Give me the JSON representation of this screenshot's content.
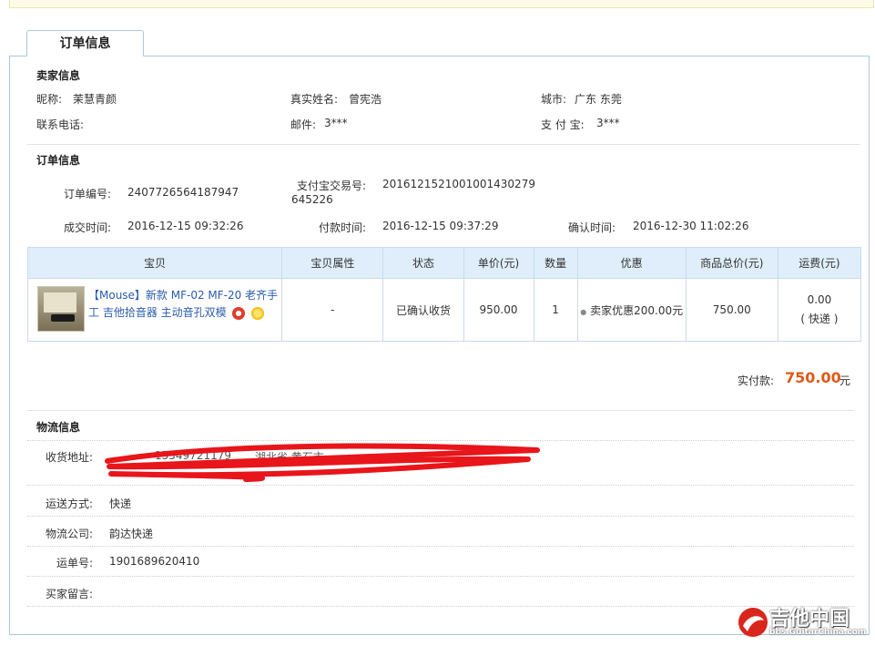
{
  "tab": {
    "label": "订单信息"
  },
  "seller": {
    "title": "卖家信息",
    "nickname_label": "昵称:",
    "nickname": "茉慧青颜",
    "realname_label": "真实姓名:",
    "realname": "曾宪浩",
    "city_label": "城市:",
    "city": "广东 东莞",
    "phone_label": "联系电话:",
    "phone": "",
    "email_label": "邮件:",
    "email": "3***",
    "alipay_label": "支 付 宝:",
    "alipay": "3***"
  },
  "order": {
    "title": "订单信息",
    "order_no_label": "订单编号:",
    "order_no": "2407726564187947",
    "trade_no_label": "支付宝交易号:",
    "trade_no_line1": "2016121521001001430279",
    "trade_no_line2": "645226",
    "deal_time_label": "成交时间:",
    "deal_time": "2016-12-15 09:32:26",
    "pay_time_label": "付款时间:",
    "pay_time": "2016-12-15 09:37:29",
    "confirm_time_label": "确认时间:",
    "confirm_time": "2016-12-30 11:02:26"
  },
  "table": {
    "headers": [
      "宝贝",
      "宝贝属性",
      "状态",
      "单价(元)",
      "数量",
      "优惠",
      "商品总价(元)",
      "运费(元)"
    ],
    "row": {
      "title_line1": "【Mouse】新款 MF-02 MF-20 老齐手",
      "title_line2": "工 吉他拾音器 主动音孔双模",
      "attribute": "-",
      "status": "已确认收货",
      "unit_price": "950.00",
      "quantity": "1",
      "discount": "卖家优惠200.00元",
      "subtotal": "750.00",
      "shipping": "0.00",
      "shipping_note": "( 快递 )"
    }
  },
  "payment": {
    "label": "实付款:",
    "amount": "750.00",
    "unit": "元"
  },
  "logistics": {
    "title": "物流信息",
    "address_label": "收货地址:",
    "address_visible_fragment_1": "15549721179",
    "address_visible_fragment_2": "湖北省 黄石市",
    "method_label": "运送方式:",
    "method": "快递",
    "company_label": "物流公司:",
    "company": "韵达快递",
    "tracking_label": "运单号:",
    "tracking": "1901689620410",
    "buyer_note_label": "买家留言:",
    "buyer_note": ""
  },
  "watermark": {
    "brand": "吉他中国",
    "url": "bbs.GuitarChina.com"
  },
  "colors": {
    "accent": "#e05a16",
    "link": "#2a5caa",
    "header_bg": "#dfeefa",
    "border": "#a9c7dc",
    "scribble": "#e8151b"
  }
}
